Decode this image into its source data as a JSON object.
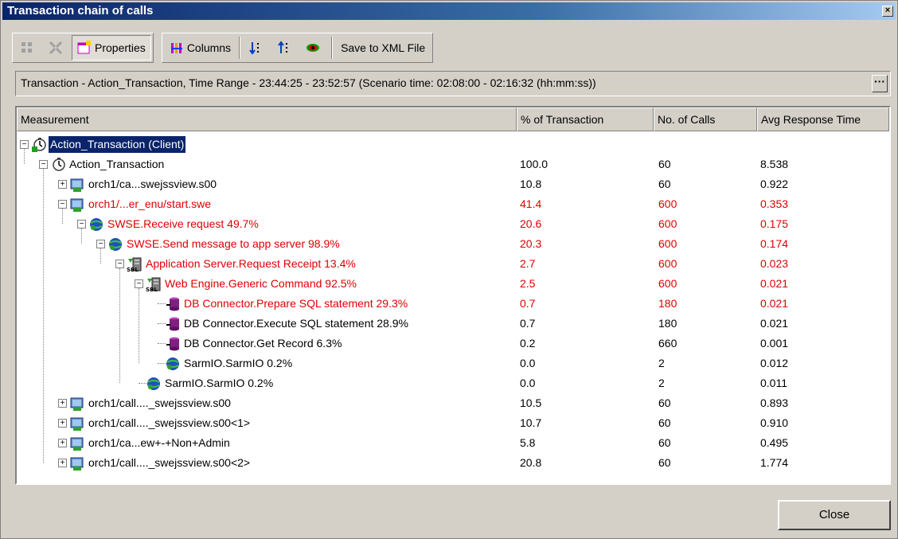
{
  "window": {
    "title": "Transaction chain of calls"
  },
  "toolbar": {
    "properties_label": "Properties",
    "columns_label": "Columns",
    "save_label": "Save to XML File"
  },
  "info": {
    "text": "Transaction - Action_Transaction, Time Range - 23:44:25 - 23:52:57 (Scenario time: 02:08:00 - 02:16:32 (hh:mm:ss))",
    "more": "···"
  },
  "columns": [
    "Measurement",
    "% of Transaction",
    "No. of Calls",
    "Avg Response Time"
  ],
  "rows": [
    {
      "label": "Action_Transaction (Client)",
      "pct": "",
      "calls": "",
      "avg": ""
    },
    {
      "label": "Action_Transaction",
      "pct": "100.0",
      "calls": "60",
      "avg": "8.538"
    },
    {
      "label": "orch1/ca...swejssview.s00",
      "pct": "10.8",
      "calls": "60",
      "avg": "0.922"
    },
    {
      "label": "orch1/...er_enu/start.swe",
      "pct": "41.4",
      "calls": "600",
      "avg": "0.353"
    },
    {
      "label": "SWSE.Receive request   49.7%",
      "pct": "20.6",
      "calls": "600",
      "avg": "0.175"
    },
    {
      "label": "SWSE.Send message to app server   98.9%",
      "pct": "20.3",
      "calls": "600",
      "avg": "0.174"
    },
    {
      "label": "Application Server.Request Receipt   13.4%",
      "pct": "2.7",
      "calls": "600",
      "avg": "0.023"
    },
    {
      "label": "Web Engine.Generic Command   92.5%",
      "pct": "2.5",
      "calls": "600",
      "avg": "0.021"
    },
    {
      "label": "DB Connector.Prepare SQL statement   29.3%",
      "pct": "0.7",
      "calls": "180",
      "avg": "0.021"
    },
    {
      "label": "DB Connector.Execute SQL statement   28.9%",
      "pct": "0.7",
      "calls": "180",
      "avg": "0.021"
    },
    {
      "label": "DB Connector.Get Record   6.3%",
      "pct": "0.2",
      "calls": "660",
      "avg": "0.001"
    },
    {
      "label": "SarmIO.SarmIO   0.2%",
      "pct": "0.0",
      "calls": "2",
      "avg": "0.012"
    },
    {
      "label": "SarmIO.SarmIO   0.2%",
      "pct": "0.0",
      "calls": "2",
      "avg": "0.011"
    },
    {
      "label": "orch1/call...._swejssview.s00",
      "pct": "10.5",
      "calls": "60",
      "avg": "0.893"
    },
    {
      "label": "orch1/call...._swejssview.s00<1>",
      "pct": "10.7",
      "calls": "60",
      "avg": "0.910"
    },
    {
      "label": "orch1/ca...ew+-+Non+Admin",
      "pct": "5.8",
      "calls": "60",
      "avg": "0.495"
    },
    {
      "label": "orch1/call...._swejssview.s00<2>",
      "pct": "20.8",
      "calls": "60",
      "avg": "1.774"
    }
  ],
  "buttons": {
    "close": "Close"
  },
  "colors": {
    "hot": "#e00000",
    "selection": "#0a246a",
    "title_start": "#0a246a"
  },
  "icons": {
    "client": "stopwatch-client-icon",
    "transaction": "stopwatch-icon",
    "url": "web-page-icon",
    "swse": "globe-icon",
    "server": "sbl-server-icon",
    "db": "database-icon"
  }
}
